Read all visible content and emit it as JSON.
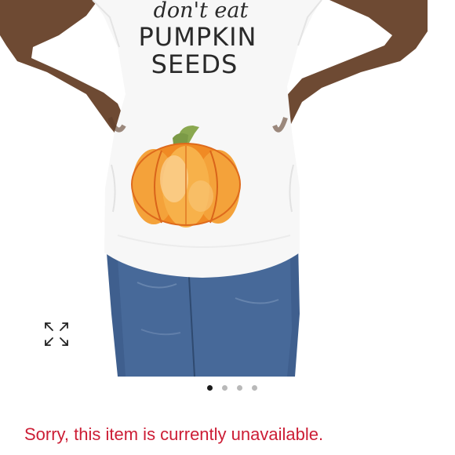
{
  "product_image": {
    "shirt_text_line1": "don't eat",
    "shirt_text_line2": "PUMPKIN",
    "shirt_text_line3": "SEEDS"
  },
  "gallery": {
    "slide_count": 4,
    "active_slide": 1
  },
  "status_message": "Sorry, this item is currently unavailable.",
  "colors": {
    "status_red": "#cc1d35",
    "dot_active": "#1a1a1a",
    "dot_inactive": "#b9b9b9"
  }
}
